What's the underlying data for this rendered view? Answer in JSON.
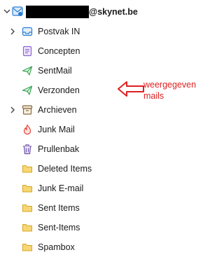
{
  "account": {
    "email_domain": "@skynet.be",
    "expanded": true
  },
  "folders": [
    {
      "label": "Postvak IN",
      "icon": "inbox-icon",
      "expandable": true
    },
    {
      "label": "Concepten",
      "icon": "drafts-icon",
      "expandable": false
    },
    {
      "label": "SentMail",
      "icon": "sent-icon",
      "expandable": false
    },
    {
      "label": "Verzonden",
      "icon": "sent-icon",
      "expandable": false
    },
    {
      "label": "Archieven",
      "icon": "archive-icon",
      "expandable": true
    },
    {
      "label": "Junk Mail",
      "icon": "junk-flame-icon",
      "expandable": false
    },
    {
      "label": "Prullenbak",
      "icon": "trash-icon",
      "expandable": false
    },
    {
      "label": "Deleted Items",
      "icon": "folder-icon",
      "expandable": false
    },
    {
      "label": "Junk E-mail",
      "icon": "folder-icon",
      "expandable": false
    },
    {
      "label": "Sent Items",
      "icon": "folder-icon",
      "expandable": false
    },
    {
      "label": "Sent-Items",
      "icon": "folder-icon",
      "expandable": false
    },
    {
      "label": "Spambox",
      "icon": "folder-icon",
      "expandable": false
    }
  ],
  "annotation": {
    "line1": "weergegeven",
    "line2": "mails",
    "color": "#e02020"
  },
  "colors": {
    "accent_blue": "#2b7cd3",
    "sent_green": "#3aa655",
    "drafts_purple": "#8a63d2",
    "archive_brown": "#8a6a3e",
    "junk_red": "#e8483b",
    "trash_purple": "#6a4ea8",
    "folder_yellow": "#f2c94c"
  }
}
